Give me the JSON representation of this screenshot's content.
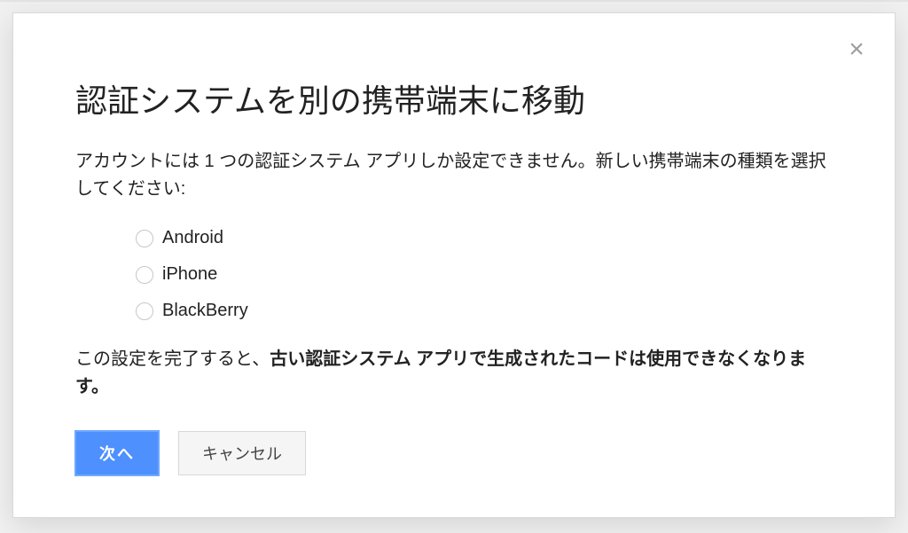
{
  "dialog": {
    "title": "認証システムを別の携帯端末に移動",
    "description": "アカウントには 1 つの認証システム アプリしか設定できません。新しい携帯端末の種類を選択してください:",
    "options": [
      {
        "label": "Android"
      },
      {
        "label": "iPhone"
      },
      {
        "label": "BlackBerry"
      }
    ],
    "warning_prefix": "この設定を完了すると、",
    "warning_bold": "古い認証システム アプリで生成されたコードは使用できなくなります。",
    "next_label": "次へ",
    "cancel_label": "キャンセル"
  }
}
